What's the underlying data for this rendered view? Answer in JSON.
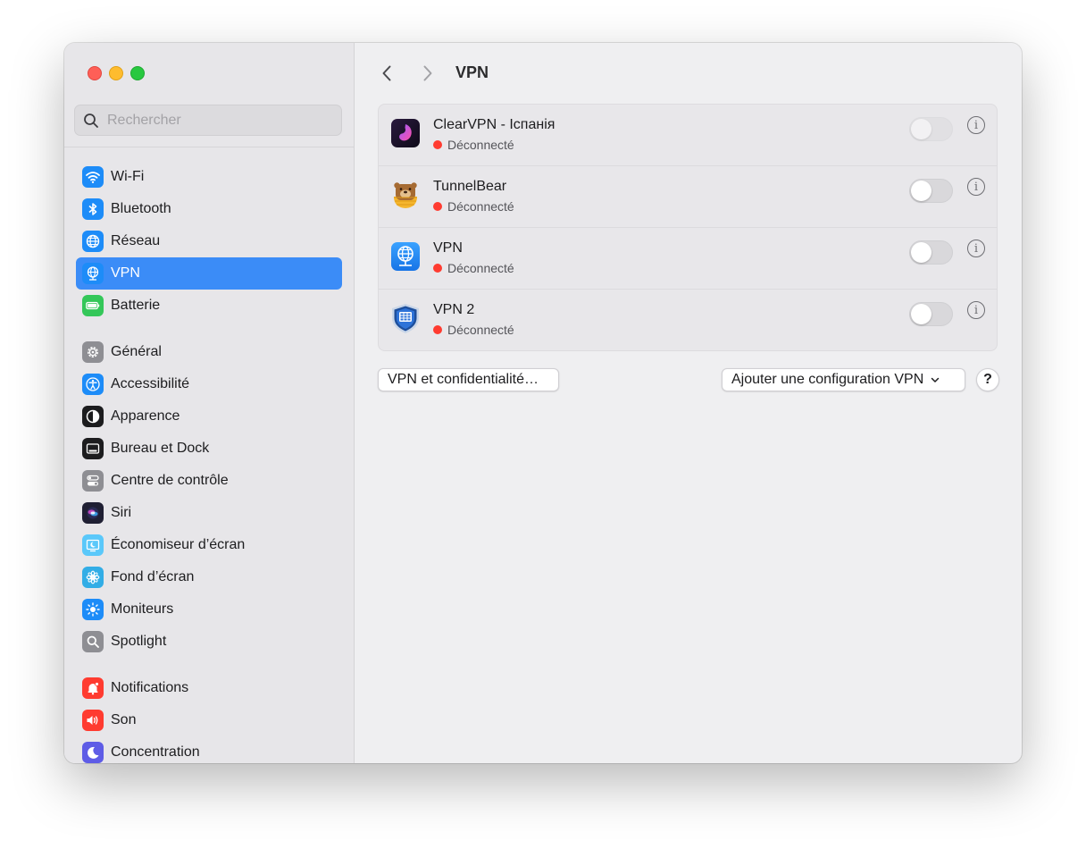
{
  "window": {
    "traffic_lights": [
      "close",
      "minimize",
      "zoom"
    ]
  },
  "sidebar": {
    "search": {
      "placeholder": "Rechercher",
      "value": ""
    },
    "groups": [
      [
        {
          "label": "Wi-Fi",
          "icon": "wifi-icon",
          "color": "#1d8cf8"
        },
        {
          "label": "Bluetooth",
          "icon": "bluetooth-icon",
          "color": "#1d8cf8"
        },
        {
          "label": "Réseau",
          "icon": "globe-icon",
          "color": "#1d8cf8"
        },
        {
          "label": "VPN",
          "icon": "vpn-globe-icon",
          "color": "#1d8cf8",
          "selected": true
        },
        {
          "label": "Batterie",
          "icon": "battery-icon",
          "color": "#34c759"
        }
      ],
      [
        {
          "label": "Général",
          "icon": "gear-icon",
          "color": "#8e8e93"
        },
        {
          "label": "Accessibilité",
          "icon": "accessibility-icon",
          "color": "#1d8cf8"
        },
        {
          "label": "Apparence",
          "icon": "appearance-icon",
          "color": "#1c1c1e"
        },
        {
          "label": "Bureau et Dock",
          "icon": "dock-icon",
          "color": "#1c1c1e"
        },
        {
          "label": "Centre de contrôle",
          "icon": "control-center-icon",
          "color": "#8e8e93"
        },
        {
          "label": "Siri",
          "icon": "siri-icon",
          "color": "#2b2b4a"
        },
        {
          "label": "Économiseur d’écran",
          "icon": "screensaver-icon",
          "color": "#5ac8fa"
        },
        {
          "label": "Fond d’écran",
          "icon": "wallpaper-icon",
          "color": "#32ade6"
        },
        {
          "label": "Moniteurs",
          "icon": "brightness-icon",
          "color": "#1d8cf8"
        },
        {
          "label": "Spotlight",
          "icon": "spotlight-icon",
          "color": "#8e8e93"
        }
      ],
      [
        {
          "label": "Notifications",
          "icon": "notifications-icon",
          "color": "#ff3b30"
        },
        {
          "label": "Son",
          "icon": "speaker-icon",
          "color": "#ff3b30"
        },
        {
          "label": "Concentration",
          "icon": "moon-icon",
          "color": "#5e5ce6"
        }
      ]
    ]
  },
  "main": {
    "title": "VPN",
    "vpns": [
      {
        "name": "ClearVPN - Іспанія",
        "status": "Déconnecté",
        "status_color": "#ff3b30",
        "icon": "clearvpn-icon",
        "enabled": false,
        "toggle_disabled": true
      },
      {
        "name": "TunnelBear",
        "status": "Déconnecté",
        "status_color": "#ff3b30",
        "icon": "tunnelbear-icon",
        "enabled": false,
        "toggle_disabled": false
      },
      {
        "name": "VPN",
        "status": "Déconnecté",
        "status_color": "#ff3b30",
        "icon": "vpn-globe-icon",
        "enabled": false,
        "toggle_disabled": false
      },
      {
        "name": "VPN 2",
        "status": "Déconnecté",
        "status_color": "#ff3b30",
        "icon": "shield-vpn-icon",
        "enabled": false,
        "toggle_disabled": false
      }
    ],
    "privacy_button": "VPN et confidentialité…",
    "add_button": "Ajouter une configuration VPN",
    "help_button": "?",
    "info_glyph": "i"
  }
}
